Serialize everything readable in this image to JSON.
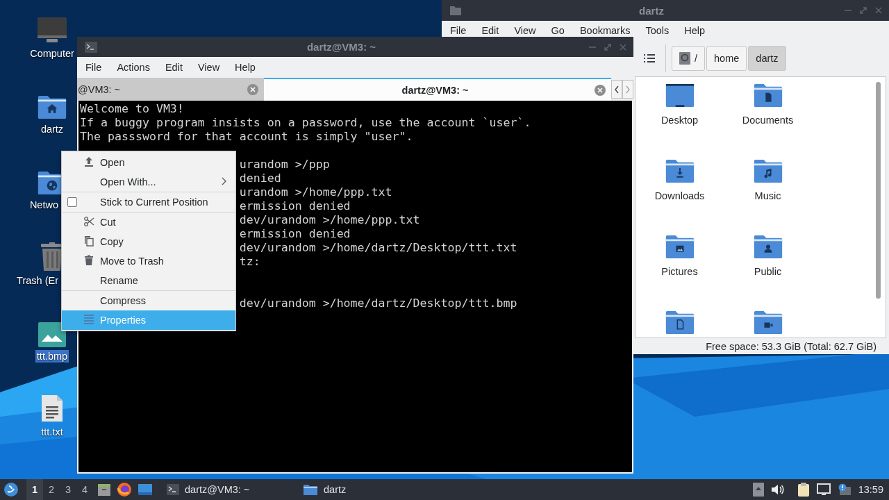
{
  "desktop_icons": [
    {
      "label": "Computer",
      "kind": "computer",
      "selected": false
    },
    {
      "label": "dartz",
      "kind": "home",
      "selected": false
    },
    {
      "label": "Netwo",
      "kind": "network",
      "selected": false
    },
    {
      "label": "Trash (Er",
      "kind": "trash",
      "selected": false
    },
    {
      "label": "ttt.bmp",
      "kind": "image",
      "selected": true
    },
    {
      "label": "ttt.txt",
      "kind": "text",
      "selected": false
    }
  ],
  "file_manager": {
    "title": "dartz",
    "menu": [
      "File",
      "Edit",
      "View",
      "Go",
      "Bookmarks",
      "Tools",
      "Help"
    ],
    "path": [
      {
        "label": "/",
        "kind": "root",
        "selected": false
      },
      {
        "label": "home",
        "kind": "dir",
        "selected": false
      },
      {
        "label": "dartz",
        "kind": "dir",
        "selected": true
      }
    ],
    "items": [
      {
        "label": "Desktop",
        "kind": "desktop"
      },
      {
        "label": "Documents",
        "kind": "document"
      },
      {
        "label": "Downloads",
        "kind": "download"
      },
      {
        "label": "Music",
        "kind": "music"
      },
      {
        "label": "Pictures",
        "kind": "picture"
      },
      {
        "label": "Public",
        "kind": "person"
      },
      {
        "kind": "page"
      },
      {
        "kind": "camera"
      }
    ],
    "status": "Free space: 53.3 GiB (Total: 62.7 GiB)"
  },
  "terminal": {
    "title": "dartz@VM3: ~",
    "menu": [
      "File",
      "Actions",
      "Edit",
      "View",
      "Help"
    ],
    "tabs": [
      {
        "label": "@VM3: ~",
        "selected": false
      },
      {
        "label": "dartz@VM3: ~",
        "selected": true
      }
    ],
    "lines": [
      {
        "kind": "full",
        "text": "Welcome to VM3!"
      },
      {
        "kind": "full",
        "text": "If a buggy program insists on a password, use the account `user`."
      },
      {
        "kind": "full",
        "text": "The passsword for that account is simply \"user\"."
      },
      {
        "kind": "blank"
      },
      {
        "kind": "covered",
        "text": "urandom >/ppp"
      },
      {
        "kind": "covered",
        "text": "denied"
      },
      {
        "kind": "covered",
        "text": "urandom >/home/ppp.txt"
      },
      {
        "kind": "covered",
        "text": "ermission denied"
      },
      {
        "kind": "covered",
        "text": "dev/urandom >/home/ppp.txt"
      },
      {
        "kind": "covered",
        "text": "ermission denied"
      },
      {
        "kind": "covered",
        "text": "dev/urandom >/home/dartz/Desktop/ttt.txt"
      },
      {
        "kind": "covered",
        "text": "tz:"
      },
      {
        "kind": "blank"
      },
      {
        "kind": "blank"
      },
      {
        "kind": "covered",
        "text": "dev/urandom >/home/dartz/Desktop/ttt.bmp"
      }
    ]
  },
  "context_menu": {
    "groups": [
      {
        "items": [
          {
            "label": "Open",
            "kind": "open",
            "selected": false
          },
          {
            "label": "Open With...",
            "kind": "submenu",
            "selected": false
          }
        ]
      },
      {
        "items": [
          {
            "label": "Stick to Current Position",
            "kind": "checkbox",
            "checked": false,
            "selected": false
          }
        ]
      },
      {
        "items": [
          {
            "label": "Cut",
            "kind": "cut",
            "selected": false
          },
          {
            "label": "Copy",
            "kind": "copy",
            "selected": false
          },
          {
            "label": "Move to Trash",
            "kind": "trash",
            "selected": false
          },
          {
            "label": "Rename",
            "kind": "plain",
            "selected": false
          }
        ]
      },
      {
        "items": [
          {
            "label": "Compress",
            "kind": "plain",
            "selected": false
          },
          {
            "label": "Properties",
            "kind": "properties",
            "selected": true
          }
        ]
      }
    ]
  },
  "taskbar": {
    "workspaces": [
      {
        "label": "1",
        "selected": true
      },
      {
        "label": "2",
        "selected": false
      },
      {
        "label": "3",
        "selected": false
      },
      {
        "label": "4",
        "selected": false
      }
    ],
    "tasks": [
      {
        "label": "dartz@VM3: ~",
        "kind": "terminal"
      },
      {
        "label": "dartz",
        "kind": "folder"
      }
    ],
    "clock": "13:59"
  }
}
